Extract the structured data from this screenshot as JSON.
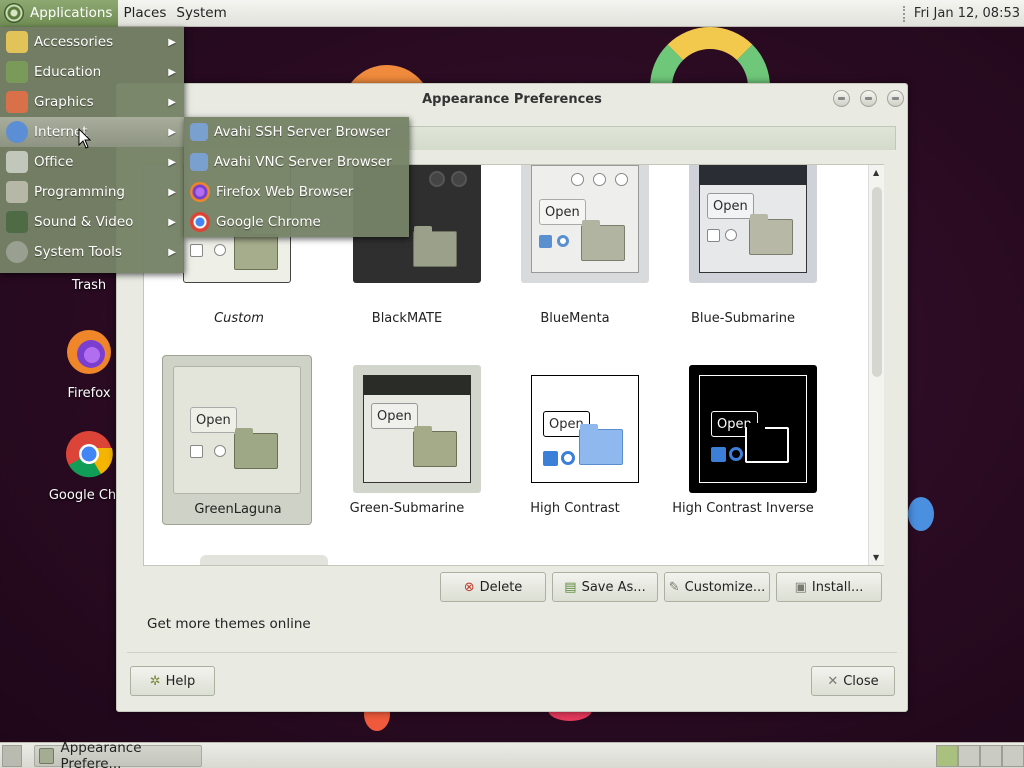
{
  "top_panel": {
    "menus": [
      "Applications",
      "Places",
      "System"
    ],
    "clock": "Fri Jan 12, 08:53"
  },
  "desktop": {
    "icons": [
      {
        "label": "Trash",
        "icon": "trash-icon"
      },
      {
        "label": "Firefox",
        "icon": "firefox-icon"
      },
      {
        "label": "Google Chro",
        "icon": "chrome-icon"
      }
    ]
  },
  "apps_menu": {
    "items": [
      {
        "label": "Accessories",
        "icon": "accessories-icon",
        "color": "#e1c35a"
      },
      {
        "label": "Education",
        "icon": "education-icon",
        "color": "#7a9a5a"
      },
      {
        "label": "Graphics",
        "icon": "graphics-icon",
        "color": "#d8704a"
      },
      {
        "label": "Internet",
        "icon": "internet-icon",
        "color": "#5b8ed4"
      },
      {
        "label": "Office",
        "icon": "office-icon",
        "color": "#c2c7bb"
      },
      {
        "label": "Programming",
        "icon": "programming-icon",
        "color": "#b7b7a8"
      },
      {
        "label": "Sound & Video",
        "icon": "sound-video-icon",
        "color": "#4e6b46"
      },
      {
        "label": "System Tools",
        "icon": "system-tools-icon",
        "color": "#9aa091"
      }
    ],
    "highlighted_index": 3
  },
  "internet_submenu": {
    "items": [
      {
        "label": "Avahi SSH Server Browser",
        "icon": "network-browser-icon",
        "color": "#7aa0d0"
      },
      {
        "label": "Avahi VNC Server Browser",
        "icon": "network-browser-icon",
        "color": "#7aa0d0"
      },
      {
        "label": "Firefox Web Browser",
        "icon": "firefox-icon",
        "color": "#f0862a"
      },
      {
        "label": "Google Chrome",
        "icon": "chrome-icon",
        "color": "#3f85f2"
      }
    ]
  },
  "window": {
    "title": "Appearance Preferences",
    "themes": [
      {
        "name": "Custom",
        "italic": true,
        "selected": false
      },
      {
        "name": "BlackMATE",
        "selected": false
      },
      {
        "name": "BlueMenta",
        "selected": false
      },
      {
        "name": "Blue-Submarine",
        "selected": false
      },
      {
        "name": "GreenLaguna",
        "selected": true
      },
      {
        "name": "Green-Submarine",
        "selected": false
      },
      {
        "name": "High Contrast",
        "selected": false
      },
      {
        "name": "High Contrast Inverse",
        "selected": false
      }
    ],
    "thumb_open_label": "Open",
    "buttons": {
      "delete": "Delete",
      "save_as": "Save As...",
      "customize": "Customize...",
      "install": "Install..."
    },
    "get_more": "Get more themes online",
    "help": "Help",
    "close": "Close"
  },
  "taskbar": {
    "task": "Appearance Prefere..."
  }
}
